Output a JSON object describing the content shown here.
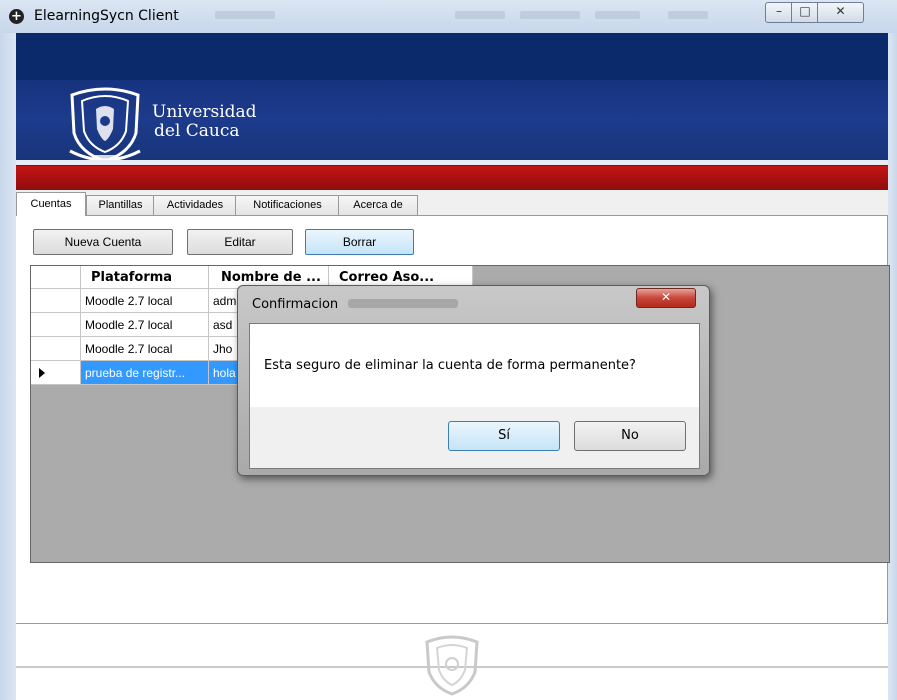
{
  "window": {
    "title": "ElearningSycn Client",
    "app_icon": "plus-circle-icon",
    "controls": {
      "minimize_icon": "minimize-icon",
      "maximize_icon": "maximize-icon",
      "close_icon": "close-icon"
    }
  },
  "banner": {
    "logo": "university-shield-logo",
    "name_line1": "Universidad",
    "name_line2": "del Cauca",
    "colors": {
      "blue": "#1d3b8c",
      "red": "#c41414"
    }
  },
  "tabs": [
    {
      "label": "Cuentas",
      "active": true
    },
    {
      "label": "Plantillas",
      "active": false
    },
    {
      "label": "Actividades",
      "active": false
    },
    {
      "label": "Notificaciones",
      "active": false
    },
    {
      "label": "Acerca de",
      "active": false
    }
  ],
  "toolbar": {
    "new_label": "Nueva Cuenta",
    "edit_label": "Editar",
    "delete_label": "Borrar"
  },
  "grid": {
    "columns": [
      "Plataforma",
      "Nombre de ...",
      "Correo Aso..."
    ],
    "rows": [
      {
        "plataforma": "Moodle 2.7 local",
        "nombre": "adm",
        "correo": ""
      },
      {
        "plataforma": "Moodle 2.7 local",
        "nombre": "asd",
        "correo": ""
      },
      {
        "plataforma": "Moodle 2.7 local",
        "nombre": "Jho",
        "correo": ""
      },
      {
        "plataforma": "prueba de registr...",
        "nombre": "hola",
        "correo": "",
        "selected": true
      }
    ],
    "selected_row_color": "#3399ff"
  },
  "dialog": {
    "title": "Confirmacion",
    "close_icon": "close-icon",
    "message": "Esta seguro de eliminar la cuenta de forma permanente?",
    "yes_label": "Sí",
    "no_label": "No"
  },
  "footer": {
    "logo": "university-seal-watermark"
  }
}
